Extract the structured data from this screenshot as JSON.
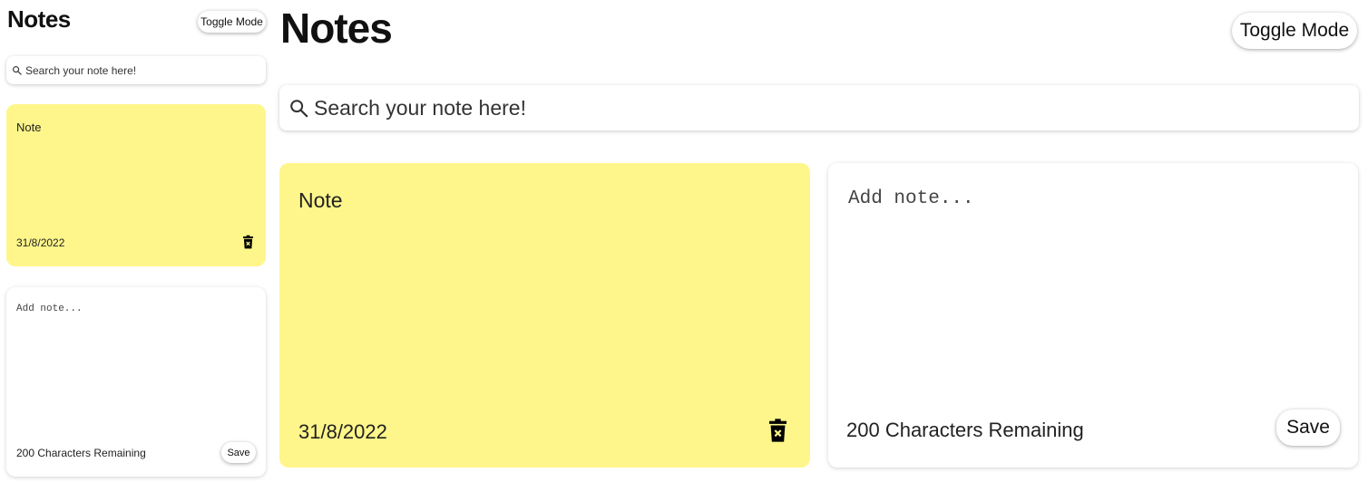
{
  "app": {
    "title": "Notes",
    "toggle_mode_label": "Toggle Mode"
  },
  "search": {
    "placeholder": "Search your note here!"
  },
  "notes": [
    {
      "text": "Note",
      "date": "31/8/2022"
    }
  ],
  "new_note": {
    "placeholder": "Add note...",
    "remaining_label": "200 Characters Remaining",
    "save_label": "Save"
  },
  "colors": {
    "note_background": "#fef68a",
    "card_background": "#ffffff"
  },
  "icons": {
    "search": "search-icon",
    "delete": "trash-icon"
  }
}
